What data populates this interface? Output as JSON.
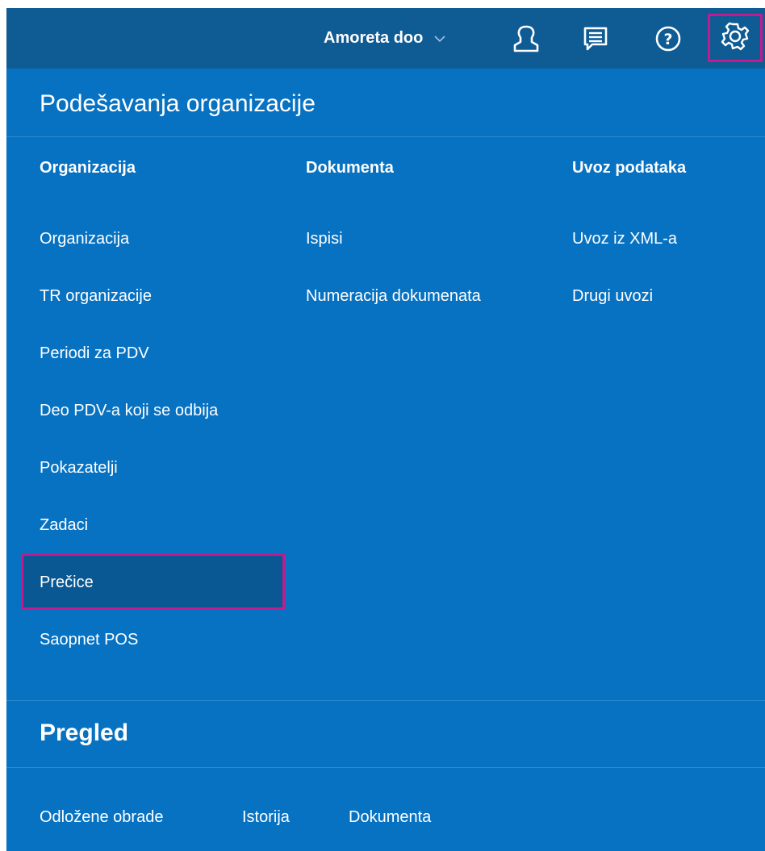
{
  "header": {
    "organization": "Amoreta doo",
    "icons": [
      "user-icon",
      "messages-icon",
      "help-icon",
      "settings-gear-icon"
    ]
  },
  "panel": {
    "title": "Podešavanja organizacije",
    "columns": [
      {
        "heading": "Organizacija",
        "items": [
          "Organizacija",
          "TR organizacije",
          "Periodi za PDV",
          "Deo PDV-a koji se odbija",
          "Pokazatelji",
          "Zadaci",
          "Prečice",
          "Saopnet POS"
        ]
      },
      {
        "heading": "Dokumenta",
        "items": [
          "Ispisi",
          "Numeracija dokumenata"
        ]
      },
      {
        "heading": "Uvoz podataka",
        "items": [
          "Uvoz iz XML-a",
          "Drugi uvozi"
        ]
      }
    ],
    "active_item": "Prečice"
  },
  "overview": {
    "title": "Pregled",
    "links": [
      "Odložene obrade",
      "Istorija",
      "Dokumenta"
    ]
  },
  "colors": {
    "topbar": "#0f5b94",
    "panel": "#0872c2",
    "highlight": "#c41a8f"
  }
}
